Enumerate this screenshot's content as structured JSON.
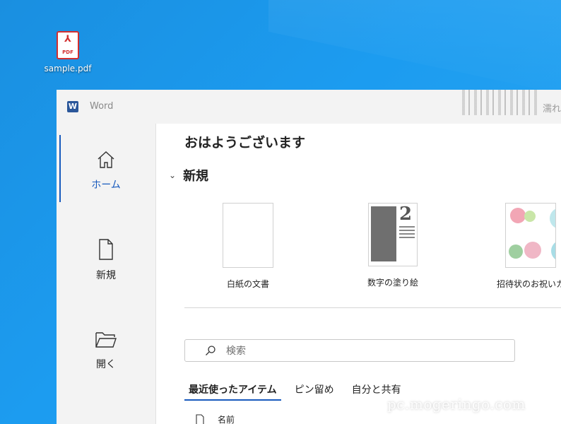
{
  "desktop": {
    "icon_label": "sample.pdf",
    "icon_tag": "PDF"
  },
  "window": {
    "app_name": "Word",
    "title_right": "濡れ"
  },
  "sidebar": {
    "items": [
      {
        "label": "ホーム",
        "icon": "home-icon"
      },
      {
        "label": "新規",
        "icon": "new-document-icon"
      },
      {
        "label": "開く",
        "icon": "open-folder-icon"
      }
    ]
  },
  "main": {
    "greeting": "おはようございます",
    "new_section_title": "新規",
    "templates": [
      {
        "label": "白紙の文書"
      },
      {
        "label": "数字の塗り絵"
      },
      {
        "label": "招待状のお祝いカ"
      }
    ],
    "search_placeholder": "検索",
    "tabs": [
      "最近使ったアイテム",
      "ピン留め",
      "自分と共有"
    ],
    "list_column_name": "名前"
  },
  "watermark": "pc.mogeringo.com",
  "colors": {
    "accent": "#185abd",
    "desktop": "#1c9cf0",
    "word_brand": "#2b579a"
  }
}
